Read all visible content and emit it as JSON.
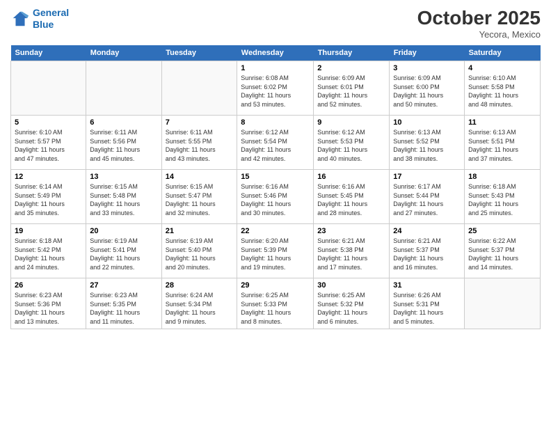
{
  "header": {
    "logo_line1": "General",
    "logo_line2": "Blue",
    "month": "October 2025",
    "location": "Yecora, Mexico"
  },
  "days_of_week": [
    "Sunday",
    "Monday",
    "Tuesday",
    "Wednesday",
    "Thursday",
    "Friday",
    "Saturday"
  ],
  "weeks": [
    [
      {
        "day": "",
        "info": ""
      },
      {
        "day": "",
        "info": ""
      },
      {
        "day": "",
        "info": ""
      },
      {
        "day": "1",
        "info": "Sunrise: 6:08 AM\nSunset: 6:02 PM\nDaylight: 11 hours\nand 53 minutes."
      },
      {
        "day": "2",
        "info": "Sunrise: 6:09 AM\nSunset: 6:01 PM\nDaylight: 11 hours\nand 52 minutes."
      },
      {
        "day": "3",
        "info": "Sunrise: 6:09 AM\nSunset: 6:00 PM\nDaylight: 11 hours\nand 50 minutes."
      },
      {
        "day": "4",
        "info": "Sunrise: 6:10 AM\nSunset: 5:58 PM\nDaylight: 11 hours\nand 48 minutes."
      }
    ],
    [
      {
        "day": "5",
        "info": "Sunrise: 6:10 AM\nSunset: 5:57 PM\nDaylight: 11 hours\nand 47 minutes."
      },
      {
        "day": "6",
        "info": "Sunrise: 6:11 AM\nSunset: 5:56 PM\nDaylight: 11 hours\nand 45 minutes."
      },
      {
        "day": "7",
        "info": "Sunrise: 6:11 AM\nSunset: 5:55 PM\nDaylight: 11 hours\nand 43 minutes."
      },
      {
        "day": "8",
        "info": "Sunrise: 6:12 AM\nSunset: 5:54 PM\nDaylight: 11 hours\nand 42 minutes."
      },
      {
        "day": "9",
        "info": "Sunrise: 6:12 AM\nSunset: 5:53 PM\nDaylight: 11 hours\nand 40 minutes."
      },
      {
        "day": "10",
        "info": "Sunrise: 6:13 AM\nSunset: 5:52 PM\nDaylight: 11 hours\nand 38 minutes."
      },
      {
        "day": "11",
        "info": "Sunrise: 6:13 AM\nSunset: 5:51 PM\nDaylight: 11 hours\nand 37 minutes."
      }
    ],
    [
      {
        "day": "12",
        "info": "Sunrise: 6:14 AM\nSunset: 5:49 PM\nDaylight: 11 hours\nand 35 minutes."
      },
      {
        "day": "13",
        "info": "Sunrise: 6:15 AM\nSunset: 5:48 PM\nDaylight: 11 hours\nand 33 minutes."
      },
      {
        "day": "14",
        "info": "Sunrise: 6:15 AM\nSunset: 5:47 PM\nDaylight: 11 hours\nand 32 minutes."
      },
      {
        "day": "15",
        "info": "Sunrise: 6:16 AM\nSunset: 5:46 PM\nDaylight: 11 hours\nand 30 minutes."
      },
      {
        "day": "16",
        "info": "Sunrise: 6:16 AM\nSunset: 5:45 PM\nDaylight: 11 hours\nand 28 minutes."
      },
      {
        "day": "17",
        "info": "Sunrise: 6:17 AM\nSunset: 5:44 PM\nDaylight: 11 hours\nand 27 minutes."
      },
      {
        "day": "18",
        "info": "Sunrise: 6:18 AM\nSunset: 5:43 PM\nDaylight: 11 hours\nand 25 minutes."
      }
    ],
    [
      {
        "day": "19",
        "info": "Sunrise: 6:18 AM\nSunset: 5:42 PM\nDaylight: 11 hours\nand 24 minutes."
      },
      {
        "day": "20",
        "info": "Sunrise: 6:19 AM\nSunset: 5:41 PM\nDaylight: 11 hours\nand 22 minutes."
      },
      {
        "day": "21",
        "info": "Sunrise: 6:19 AM\nSunset: 5:40 PM\nDaylight: 11 hours\nand 20 minutes."
      },
      {
        "day": "22",
        "info": "Sunrise: 6:20 AM\nSunset: 5:39 PM\nDaylight: 11 hours\nand 19 minutes."
      },
      {
        "day": "23",
        "info": "Sunrise: 6:21 AM\nSunset: 5:38 PM\nDaylight: 11 hours\nand 17 minutes."
      },
      {
        "day": "24",
        "info": "Sunrise: 6:21 AM\nSunset: 5:37 PM\nDaylight: 11 hours\nand 16 minutes."
      },
      {
        "day": "25",
        "info": "Sunrise: 6:22 AM\nSunset: 5:37 PM\nDaylight: 11 hours\nand 14 minutes."
      }
    ],
    [
      {
        "day": "26",
        "info": "Sunrise: 6:23 AM\nSunset: 5:36 PM\nDaylight: 11 hours\nand 13 minutes."
      },
      {
        "day": "27",
        "info": "Sunrise: 6:23 AM\nSunset: 5:35 PM\nDaylight: 11 hours\nand 11 minutes."
      },
      {
        "day": "28",
        "info": "Sunrise: 6:24 AM\nSunset: 5:34 PM\nDaylight: 11 hours\nand 9 minutes."
      },
      {
        "day": "29",
        "info": "Sunrise: 6:25 AM\nSunset: 5:33 PM\nDaylight: 11 hours\nand 8 minutes."
      },
      {
        "day": "30",
        "info": "Sunrise: 6:25 AM\nSunset: 5:32 PM\nDaylight: 11 hours\nand 6 minutes."
      },
      {
        "day": "31",
        "info": "Sunrise: 6:26 AM\nSunset: 5:31 PM\nDaylight: 11 hours\nand 5 minutes."
      },
      {
        "day": "",
        "info": ""
      }
    ]
  ]
}
